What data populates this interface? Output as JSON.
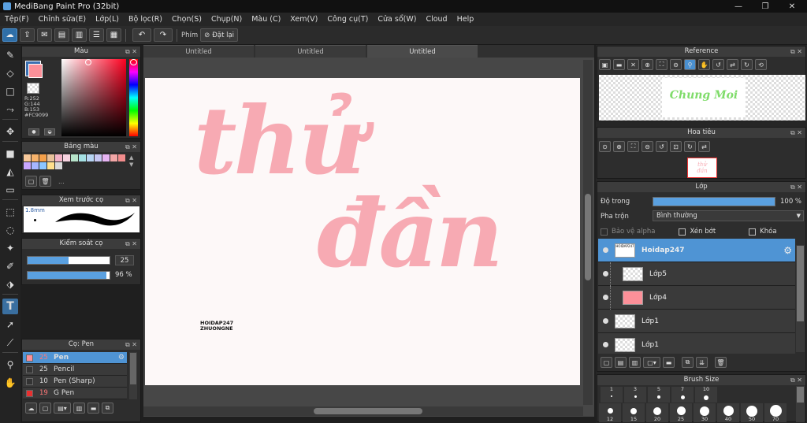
{
  "app": {
    "title": "MediBang Paint Pro (32bit)"
  },
  "window_controls": {
    "minimize": "—",
    "maximize": "❐",
    "close": "✕"
  },
  "menu": [
    "Tệp(F)",
    "Chỉnh sửa(E)",
    "Lớp(L)",
    "Bộ lọc(R)",
    "Chọn(S)",
    "Chụp(N)",
    "Màu (C)",
    "Xem(V)",
    "Công cụ(T)",
    "Cửa sổ(W)",
    "Cloud",
    "Help"
  ],
  "toolbar": {
    "phim_label": "Phím",
    "reset_label": "Đặt lại"
  },
  "color_panel": {
    "title": "Màu",
    "r": "R:252",
    "g": "G:144",
    "b": "B:153",
    "hex": "#FC9099",
    "fg_color": "#fc9099",
    "bg_color": "#3a6fb0"
  },
  "palette_panel": {
    "title": "Bảng màu",
    "dots": "...",
    "colors": [
      "#f7c89a",
      "#f6b26b",
      "#f4a04a",
      "#e8c19a",
      "#f3b3c7",
      "#f7d3e0",
      "#b6e3c9",
      "#a4e0e3",
      "#b6d4f2",
      "#c6c6f2",
      "#e6b3f2",
      "#f2a6a6",
      "#f28c8c",
      "#c9a6ff",
      "#a6b6ff",
      "#8cc6ff",
      "#ffe08c",
      "#d9d9d9"
    ]
  },
  "brush_preview_panel": {
    "title": "Xem trước cọ",
    "size": "1.8mm"
  },
  "brush_control_panel": {
    "title": "Kiểm soát cọ",
    "size_value": "25",
    "opacity_value": "96 %",
    "size_fraction": 0.5,
    "opacity_fraction": 0.96
  },
  "brush_panel": {
    "title": "Cọ: Pen",
    "items": [
      {
        "size": "25",
        "name": "Pen",
        "color": "#fc9099",
        "selected": true
      },
      {
        "size": "25",
        "name": "Pencil",
        "color": "#333333",
        "selected": false
      },
      {
        "size": "10",
        "name": "Pen (Sharp)",
        "color": "#333333",
        "selected": false
      },
      {
        "size": "19",
        "name": "G Pen",
        "color": "#e83030",
        "selected": false
      }
    ]
  },
  "tabs": [
    "Untitled",
    "Untitled",
    "Untitled"
  ],
  "artwork": {
    "line1": "thử",
    "line2": "đần",
    "signature_line1": "HOIDAP247",
    "signature_line2": "ZHUONGNE"
  },
  "reference_panel": {
    "title": "Reference",
    "preview_text": "Chung Moi"
  },
  "navigator_panel": {
    "title": "Hoa tiêu"
  },
  "layer_panel": {
    "title": "Lớp",
    "opacity_label": "Độ trong",
    "opacity_value": "100 %",
    "opacity_fraction": 1.0,
    "blend_label": "Pha trộn",
    "blend_value": "Bình thường",
    "protect_alpha": "Bảo vệ alpha",
    "clipping": "Xén bớt",
    "lock": "Khóa",
    "layers": [
      {
        "name": "Hoidap247",
        "selected": true,
        "thumb": "text"
      },
      {
        "name": "Lớp5",
        "selected": false,
        "thumb": "checker"
      },
      {
        "name": "Lớp4",
        "selected": false,
        "thumb": "pink"
      },
      {
        "name": "Lớp1",
        "selected": false,
        "thumb": "checker"
      },
      {
        "name": "Lớp1",
        "selected": false,
        "thumb": "checker"
      }
    ]
  },
  "brush_size_panel": {
    "title": "Brush Size",
    "top_values": [
      "1",
      "3",
      "5",
      "7",
      "10"
    ],
    "bottom_values": [
      "12",
      "15",
      "20",
      "25",
      "30",
      "40",
      "50",
      "70"
    ]
  }
}
